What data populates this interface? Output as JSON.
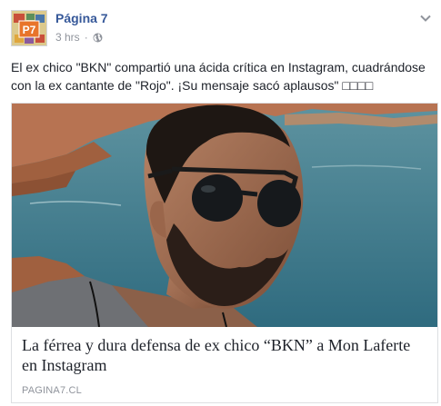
{
  "post": {
    "page_name": "Página 7",
    "avatar_label": "P7",
    "timestamp": "3 hrs",
    "separator": "·",
    "text": "El ex chico \"BKN\" compartió una ácida crítica en Instagram, cuadrándose con la ex cantante de \"Rojo\". ¡Su mensaje sacó aplausos\" □□□□",
    "privacy_icon": "globe-icon",
    "menu_icon": "chevron-down-icon"
  },
  "link_card": {
    "title": "La férrea y dura defensa de ex chico “BKN” a Mon Laferte en Instagram",
    "domain": "PAGINA7.CL"
  },
  "colors": {
    "link_blue": "#365899",
    "meta_gray": "#90949c",
    "text": "#1d2129",
    "border": "#dddfe2"
  }
}
